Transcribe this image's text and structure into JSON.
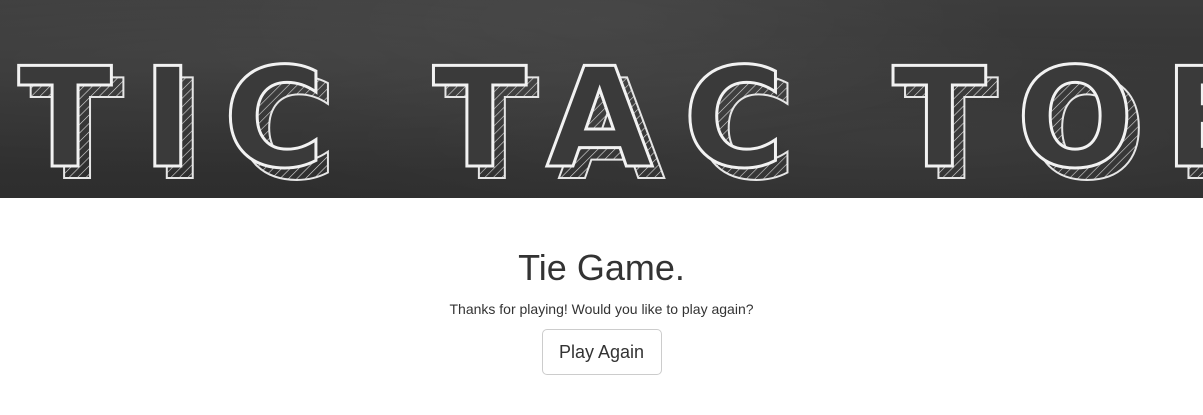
{
  "header": {
    "logo_text": "TIC TAC TOE",
    "logo_style": "chalk lettering on blackboard",
    "background_color": "#333333",
    "chalk_color": "#f2f2f2"
  },
  "result": {
    "title": "Tie Game.",
    "message": "Thanks for playing! Would you like to play again?",
    "play_again_label": "Play Again"
  }
}
